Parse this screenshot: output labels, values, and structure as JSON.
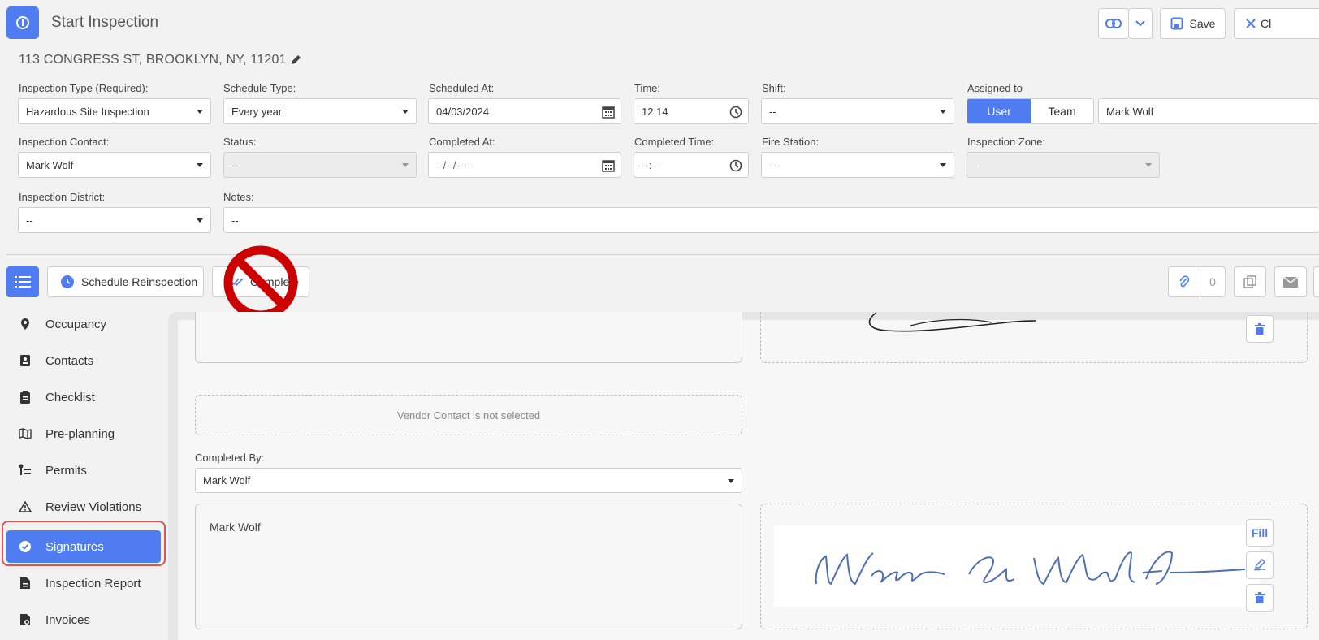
{
  "header": {
    "title": "Start Inspection",
    "save_label": "Save",
    "close_label": "Cl",
    "address": "113 CONGRESS ST, BROOKLYN, NY, 11201"
  },
  "form": {
    "inspection_type": {
      "label": "Inspection Type (Required):",
      "value": "Hazardous Site Inspection"
    },
    "schedule_type": {
      "label": "Schedule Type:",
      "value": "Every year"
    },
    "scheduled_at": {
      "label": "Scheduled At:",
      "value": "04/03/2024"
    },
    "time": {
      "label": "Time:",
      "value": "12:14"
    },
    "shift": {
      "label": "Shift:",
      "value": "--"
    },
    "assigned_to": {
      "label": "Assigned to",
      "user_label": "User",
      "team_label": "Team",
      "value": "Mark Wolf"
    },
    "inspection_contact": {
      "label": "Inspection Contact:",
      "value": "Mark Wolf"
    },
    "status": {
      "label": "Status:",
      "value": "--"
    },
    "completed_at": {
      "label": "Completed At:",
      "value": "--/--/----"
    },
    "completed_time": {
      "label": "Completed Time:",
      "value": "--:--"
    },
    "fire_station": {
      "label": "Fire Station:",
      "value": "--"
    },
    "inspection_zone": {
      "label": "Inspection Zone:",
      "value": "--"
    },
    "inspection_district": {
      "label": "Inspection District:",
      "value": "--"
    },
    "notes": {
      "label": "Notes:",
      "value": "--"
    }
  },
  "toolbar": {
    "schedule_reinspection_label": "Schedule Reinspection",
    "complete_label": "Complete",
    "attachments_count": "0"
  },
  "sidebar": {
    "items": [
      {
        "label": "Occupancy",
        "icon": "map-pin-icon"
      },
      {
        "label": "Contacts",
        "icon": "contact-card-icon"
      },
      {
        "label": "Checklist",
        "icon": "clipboard-icon"
      },
      {
        "label": "Pre-planning",
        "icon": "map-icon"
      },
      {
        "label": "Permits",
        "icon": "permit-list-icon"
      },
      {
        "label": "Review Violations",
        "icon": "warning-icon"
      },
      {
        "label": "Signatures",
        "icon": "check-circle-icon",
        "active": true
      },
      {
        "label": "Inspection Report",
        "icon": "report-icon"
      },
      {
        "label": "Invoices",
        "icon": "invoice-icon"
      }
    ]
  },
  "signatures": {
    "vendor_notice": "Vendor Contact is not selected",
    "completed_by_label": "Completed By:",
    "completed_by_value": "Mark Wolf",
    "signer_name": "Mark Wolf",
    "fill_label": "Fill"
  },
  "colors": {
    "accent": "#4f7cf0",
    "highlight": "#e05151",
    "prohibition": "#cc0000"
  }
}
